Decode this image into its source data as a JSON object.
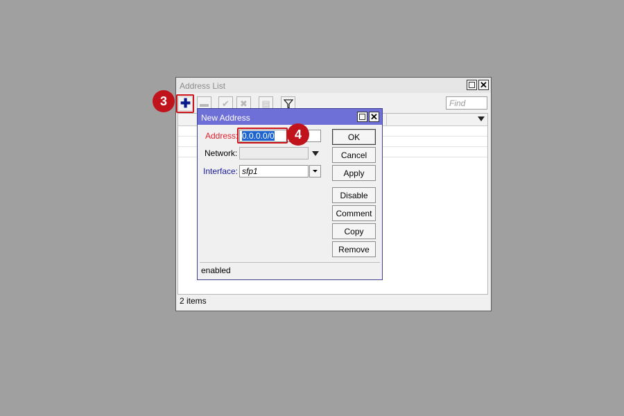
{
  "list_window": {
    "title": "Address List",
    "find_placeholder": "Find",
    "status": "2 items",
    "toolbar": {
      "add_icon": "plus-icon",
      "remove_icon": "minus-icon",
      "enable_icon": "check-icon",
      "disable_icon": "x-icon",
      "comment_icon": "note-icon",
      "filter_icon": "filter-icon"
    }
  },
  "dialog": {
    "title": "New Address",
    "fields": {
      "address": {
        "label": "Address:",
        "value": "0.0.0.0/0"
      },
      "network": {
        "label": "Network:",
        "value": ""
      },
      "interface": {
        "label": "Interface:",
        "value": "sfp1"
      }
    },
    "buttons": [
      "OK",
      "Cancel",
      "Apply",
      "Disable",
      "Comment",
      "Copy",
      "Remove"
    ],
    "status": "enabled"
  },
  "badges": {
    "step_add": "3",
    "step_address": "4"
  },
  "colors": {
    "background": "#a0a0a0",
    "dialog_titlebar": "#6f6fd8",
    "highlight": "#d0121b",
    "address_label": "#e0202a",
    "interface_label": "#1a1aa0",
    "selection": "#1e64d0"
  }
}
